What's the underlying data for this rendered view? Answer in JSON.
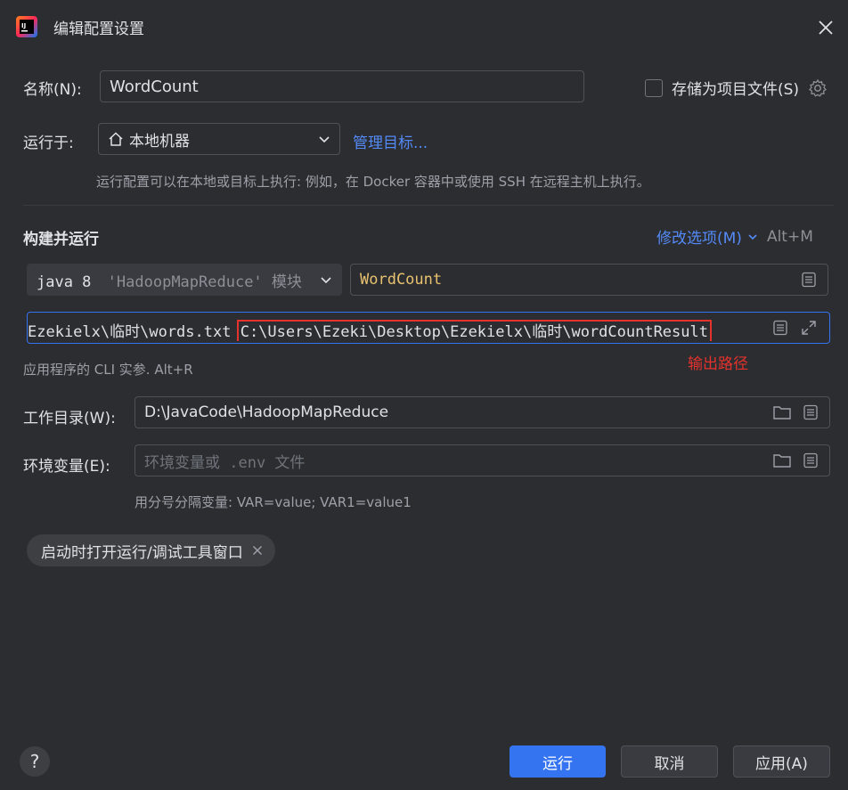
{
  "window": {
    "title": "编辑配置设置"
  },
  "name_row": {
    "label": "名称(N):",
    "value": "WordCount",
    "store_checkbox_label": "存储为项目文件(S)",
    "store_checked": false
  },
  "run_on": {
    "label": "运行于:",
    "selected": "本地机器",
    "manage_link": "管理目标...",
    "hint": "运行配置可以在本地或目标上执行: 例如，在 Docker 容器中或使用 SSH 在远程主机上执行。"
  },
  "build_run": {
    "section_title": "构建并运行",
    "modify_options": "修改选项(M)",
    "modify_shortcut": "Alt+M",
    "jdk_label": "java 8",
    "module_label": "'HadoopMapReduce' 模块",
    "main_class": "WordCount",
    "args_before": "Ezekielx\\临时\\words.txt ",
    "args_highlight": "C:\\Users\\Ezeki\\Desktop\\Ezekielx\\临时\\wordCountResult",
    "args_hint": "应用程序的 CLI 实参. Alt+R",
    "annotation": "输出路径"
  },
  "working_dir": {
    "label": "工作目录(W):",
    "value": "D:\\JavaCode\\HadoopMapReduce"
  },
  "env_vars": {
    "label": "环境变量(E):",
    "placeholder": "环境变量或 .env 文件",
    "hint": "用分号分隔变量: VAR=value; VAR1=value1"
  },
  "chip": {
    "label": "启动时打开运行/调试工具窗口"
  },
  "footer": {
    "help": "?",
    "run_label": "运行",
    "cancel_label": "取消",
    "apply_label": "应用(A)"
  },
  "colors": {
    "background": "#2b2d30",
    "accent": "#3574f0",
    "link": "#548af7",
    "annotation_red": "#e5322d",
    "class_yellow": "#e8c170"
  }
}
